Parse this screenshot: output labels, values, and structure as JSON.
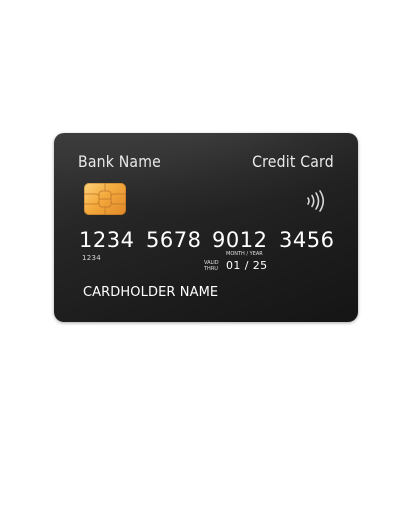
{
  "card": {
    "bank_name": "Bank Name",
    "card_type": "Credit Card",
    "number_groups": [
      "1234",
      "5678",
      "9012",
      "3456"
    ],
    "small_digits": "1234",
    "valid_label_line1": "VALID",
    "valid_label_line2": "THRU",
    "expiry_label": "MONTH / YEAR",
    "expiry": "01 / 25",
    "cardholder_name": "CARDHOLDER NAME"
  },
  "colors": {
    "card_background": "#262626",
    "chip_gold": "#f4a93c",
    "text": "#ffffff"
  },
  "icons": {
    "chip": "emv-chip-icon",
    "contactless": "contactless-icon"
  }
}
